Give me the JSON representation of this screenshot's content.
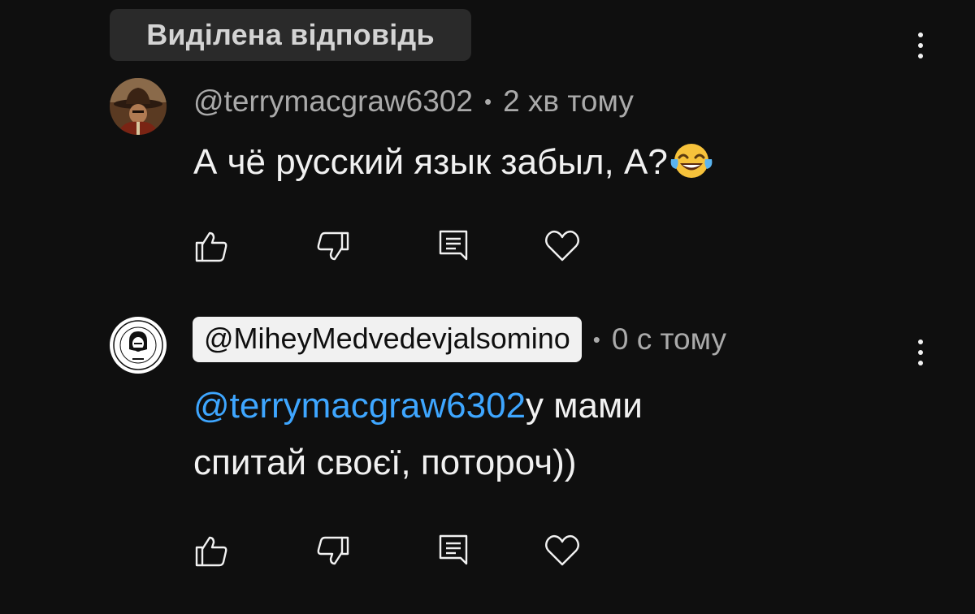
{
  "highlight": {
    "label": "Виділена відповідь"
  },
  "comments": [
    {
      "author": "@terrymacgraw6302",
      "time": "2 хв тому",
      "text": "А чё русский язык забыл, А?",
      "emoji": "face-with-tears-of-joy",
      "is_channel_owner": false
    },
    {
      "author": "@MiheyMedvedevjalsomino",
      "time": "0 с тому",
      "mention": "@terrymacgraw6302",
      "text_line1": "у мами",
      "text_line2": "спитай своєї, потороч))",
      "is_channel_owner": true
    }
  ],
  "icons": {
    "like": "thumbs-up-icon",
    "dislike": "thumbs-down-icon",
    "reply": "reply-comment-icon",
    "heart": "heart-icon",
    "more": "more-vertical-icon"
  },
  "colors": {
    "background": "#0f0f0f",
    "mention": "#3ea6ff",
    "meta": "#aaaaaa",
    "chip": "#2a2a2a"
  }
}
